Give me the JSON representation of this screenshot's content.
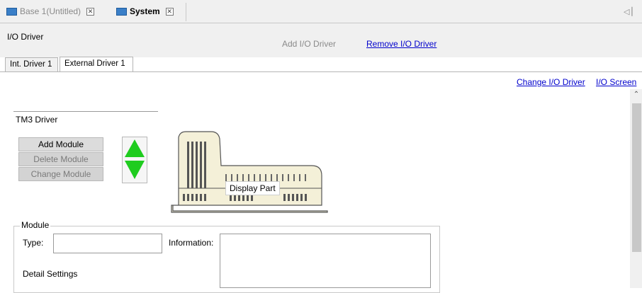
{
  "doc_tabs": [
    {
      "label": "Base 1(Untitled)",
      "icon": "screen-icon",
      "active": false
    },
    {
      "label": "System",
      "icon": "system-icon",
      "active": true
    }
  ],
  "doc_tabs_overflow": "◁ ▏",
  "header": {
    "title": "I/O Driver",
    "add_label": "Add I/O Driver",
    "remove_label": "Remove I/O Driver"
  },
  "inner_tabs": [
    {
      "label": "Int. Driver 1",
      "active": false
    },
    {
      "label": "External Driver 1",
      "active": true
    }
  ],
  "links": {
    "change_driver": "Change I/O Driver",
    "io_screen": "I/O Screen"
  },
  "driver": {
    "name": "TM3 Driver"
  },
  "buttons": {
    "add_module": "Add Module",
    "delete_module": "Delete Module",
    "change_module": "Change Module"
  },
  "tooltip": "Display Part",
  "module": {
    "group_title": "Module",
    "type_label": "Type:",
    "type_value": "",
    "info_label": "Information:",
    "info_value": "",
    "detail_label": "Detail Settings"
  },
  "colors": {
    "arrow_green": "#1fcc1f",
    "link_blue": "#0000cc",
    "device_fill": "#f4f0d8"
  }
}
